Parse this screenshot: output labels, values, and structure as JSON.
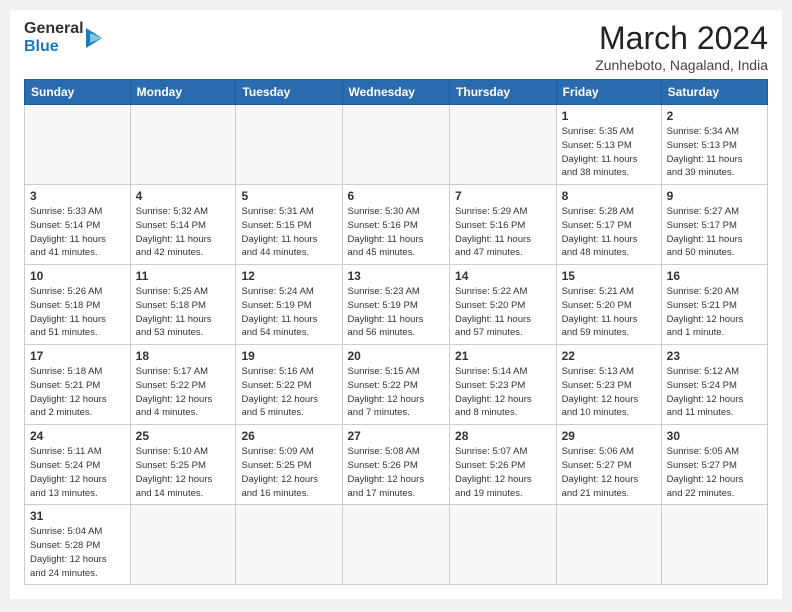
{
  "header": {
    "logo_general": "General",
    "logo_blue": "Blue",
    "month_title": "March 2024",
    "subtitle": "Zunheboto, Nagaland, India"
  },
  "days_of_week": [
    "Sunday",
    "Monday",
    "Tuesday",
    "Wednesday",
    "Thursday",
    "Friday",
    "Saturday"
  ],
  "weeks": [
    [
      {
        "day": "",
        "info": ""
      },
      {
        "day": "",
        "info": ""
      },
      {
        "day": "",
        "info": ""
      },
      {
        "day": "",
        "info": ""
      },
      {
        "day": "",
        "info": ""
      },
      {
        "day": "1",
        "info": "Sunrise: 5:35 AM\nSunset: 5:13 PM\nDaylight: 11 hours\nand 38 minutes."
      },
      {
        "day": "2",
        "info": "Sunrise: 5:34 AM\nSunset: 5:13 PM\nDaylight: 11 hours\nand 39 minutes."
      }
    ],
    [
      {
        "day": "3",
        "info": "Sunrise: 5:33 AM\nSunset: 5:14 PM\nDaylight: 11 hours\nand 41 minutes."
      },
      {
        "day": "4",
        "info": "Sunrise: 5:32 AM\nSunset: 5:14 PM\nDaylight: 11 hours\nand 42 minutes."
      },
      {
        "day": "5",
        "info": "Sunrise: 5:31 AM\nSunset: 5:15 PM\nDaylight: 11 hours\nand 44 minutes."
      },
      {
        "day": "6",
        "info": "Sunrise: 5:30 AM\nSunset: 5:16 PM\nDaylight: 11 hours\nand 45 minutes."
      },
      {
        "day": "7",
        "info": "Sunrise: 5:29 AM\nSunset: 5:16 PM\nDaylight: 11 hours\nand 47 minutes."
      },
      {
        "day": "8",
        "info": "Sunrise: 5:28 AM\nSunset: 5:17 PM\nDaylight: 11 hours\nand 48 minutes."
      },
      {
        "day": "9",
        "info": "Sunrise: 5:27 AM\nSunset: 5:17 PM\nDaylight: 11 hours\nand 50 minutes."
      }
    ],
    [
      {
        "day": "10",
        "info": "Sunrise: 5:26 AM\nSunset: 5:18 PM\nDaylight: 11 hours\nand 51 minutes."
      },
      {
        "day": "11",
        "info": "Sunrise: 5:25 AM\nSunset: 5:18 PM\nDaylight: 11 hours\nand 53 minutes."
      },
      {
        "day": "12",
        "info": "Sunrise: 5:24 AM\nSunset: 5:19 PM\nDaylight: 11 hours\nand 54 minutes."
      },
      {
        "day": "13",
        "info": "Sunrise: 5:23 AM\nSunset: 5:19 PM\nDaylight: 11 hours\nand 56 minutes."
      },
      {
        "day": "14",
        "info": "Sunrise: 5:22 AM\nSunset: 5:20 PM\nDaylight: 11 hours\nand 57 minutes."
      },
      {
        "day": "15",
        "info": "Sunrise: 5:21 AM\nSunset: 5:20 PM\nDaylight: 11 hours\nand 59 minutes."
      },
      {
        "day": "16",
        "info": "Sunrise: 5:20 AM\nSunset: 5:21 PM\nDaylight: 12 hours\nand 1 minute."
      }
    ],
    [
      {
        "day": "17",
        "info": "Sunrise: 5:18 AM\nSunset: 5:21 PM\nDaylight: 12 hours\nand 2 minutes."
      },
      {
        "day": "18",
        "info": "Sunrise: 5:17 AM\nSunset: 5:22 PM\nDaylight: 12 hours\nand 4 minutes."
      },
      {
        "day": "19",
        "info": "Sunrise: 5:16 AM\nSunset: 5:22 PM\nDaylight: 12 hours\nand 5 minutes."
      },
      {
        "day": "20",
        "info": "Sunrise: 5:15 AM\nSunset: 5:22 PM\nDaylight: 12 hours\nand 7 minutes."
      },
      {
        "day": "21",
        "info": "Sunrise: 5:14 AM\nSunset: 5:23 PM\nDaylight: 12 hours\nand 8 minutes."
      },
      {
        "day": "22",
        "info": "Sunrise: 5:13 AM\nSunset: 5:23 PM\nDaylight: 12 hours\nand 10 minutes."
      },
      {
        "day": "23",
        "info": "Sunrise: 5:12 AM\nSunset: 5:24 PM\nDaylight: 12 hours\nand 11 minutes."
      }
    ],
    [
      {
        "day": "24",
        "info": "Sunrise: 5:11 AM\nSunset: 5:24 PM\nDaylight: 12 hours\nand 13 minutes."
      },
      {
        "day": "25",
        "info": "Sunrise: 5:10 AM\nSunset: 5:25 PM\nDaylight: 12 hours\nand 14 minutes."
      },
      {
        "day": "26",
        "info": "Sunrise: 5:09 AM\nSunset: 5:25 PM\nDaylight: 12 hours\nand 16 minutes."
      },
      {
        "day": "27",
        "info": "Sunrise: 5:08 AM\nSunset: 5:26 PM\nDaylight: 12 hours\nand 17 minutes."
      },
      {
        "day": "28",
        "info": "Sunrise: 5:07 AM\nSunset: 5:26 PM\nDaylight: 12 hours\nand 19 minutes."
      },
      {
        "day": "29",
        "info": "Sunrise: 5:06 AM\nSunset: 5:27 PM\nDaylight: 12 hours\nand 21 minutes."
      },
      {
        "day": "30",
        "info": "Sunrise: 5:05 AM\nSunset: 5:27 PM\nDaylight: 12 hours\nand 22 minutes."
      }
    ],
    [
      {
        "day": "31",
        "info": "Sunrise: 5:04 AM\nSunset: 5:28 PM\nDaylight: 12 hours\nand 24 minutes."
      },
      {
        "day": "",
        "info": ""
      },
      {
        "day": "",
        "info": ""
      },
      {
        "day": "",
        "info": ""
      },
      {
        "day": "",
        "info": ""
      },
      {
        "day": "",
        "info": ""
      },
      {
        "day": "",
        "info": ""
      }
    ]
  ]
}
